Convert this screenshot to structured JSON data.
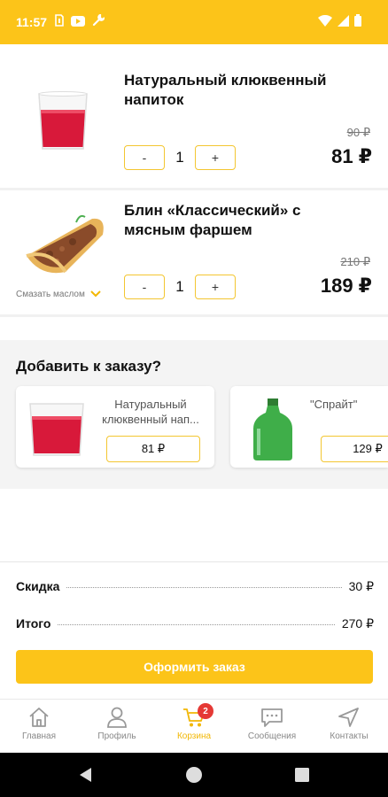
{
  "status_bar": {
    "time": "11:57"
  },
  "cart": {
    "items": [
      {
        "name": "Натуральный клюквенный напиток",
        "quantity": "1",
        "minus": "-",
        "plus": "+",
        "old_price": "90 ₽",
        "price": "81 ₽"
      },
      {
        "name": "Блин «Классический» с мясным фаршем",
        "quantity": "1",
        "minus": "-",
        "plus": "+",
        "old_price": "210 ₽",
        "price": "189 ₽",
        "option": "Смазать маслом"
      }
    ]
  },
  "addons": {
    "title": "Добавить к заказу?",
    "cards": [
      {
        "name": "Натуральный клюквенный нап...",
        "price": "81 ₽"
      },
      {
        "name": "\"Спрайт\"",
        "price": "129 ₽"
      }
    ]
  },
  "summary": {
    "discount_label": "Скидка",
    "discount_value": "30 ₽",
    "total_label": "Итого",
    "total_value": "270 ₽"
  },
  "order_button": "Оформить заказ",
  "tabbar": {
    "items": [
      {
        "label": "Главная",
        "icon": "home-icon"
      },
      {
        "label": "Профиль",
        "icon": "profile-icon"
      },
      {
        "label": "Корзина",
        "icon": "cart-icon",
        "badge": "2",
        "active": true
      },
      {
        "label": "Сообщения",
        "icon": "messages-icon"
      },
      {
        "label": "Контакты",
        "icon": "location-arrow-icon"
      }
    ]
  },
  "colors": {
    "accent": "#fcc419",
    "badge": "#e53935",
    "button_border": "#f3c631"
  }
}
